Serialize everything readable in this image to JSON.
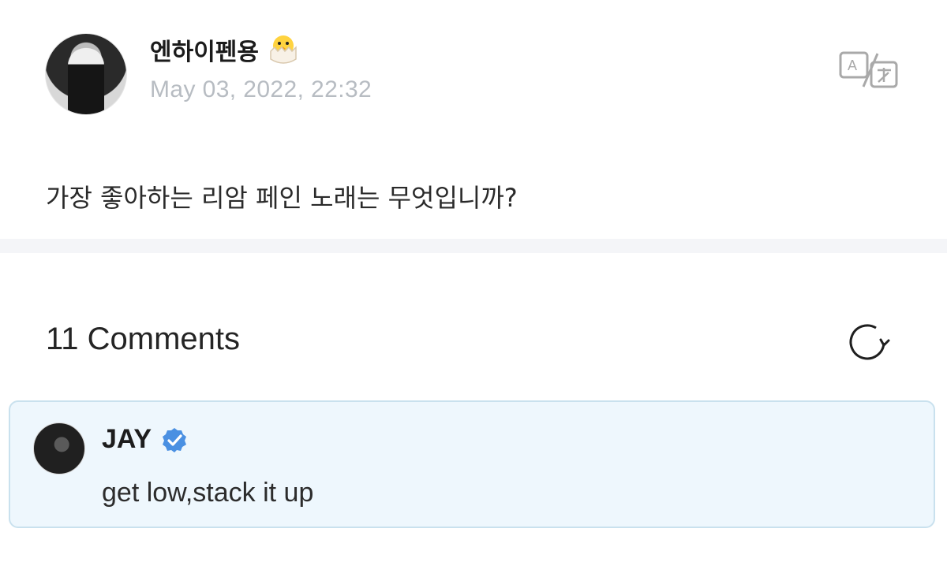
{
  "post": {
    "author": "엔하이펜용",
    "author_emoji_icon": "hatching-chick-icon",
    "date": "May 03, 2022, 22:32",
    "content": "가장 좋아하는 리암 페인 노래는 무엇입니까?",
    "translate_icon": "translate-icon"
  },
  "comments": {
    "count_label": "11 Comments",
    "refresh_icon": "refresh-icon",
    "items": [
      {
        "author": "JAY",
        "verified_icon": "verified-badge-icon",
        "text": "get low,stack it up"
      }
    ]
  },
  "colors": {
    "date_text": "#b7bcc2",
    "divider": "#f4f5f8",
    "comment_background": "#eef7fd",
    "comment_border": "#c9e1ee",
    "verified_badge": "#4a90e2"
  }
}
